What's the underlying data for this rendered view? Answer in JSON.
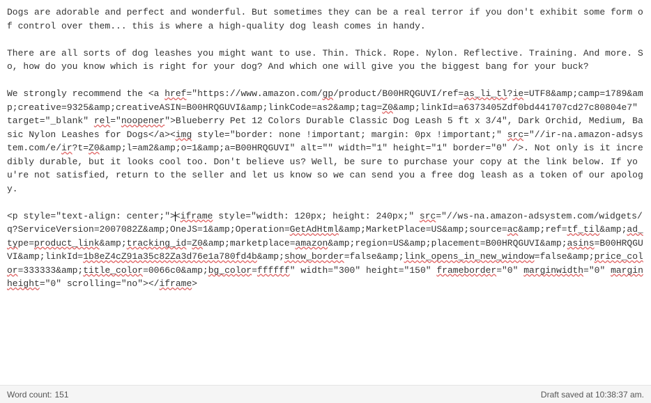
{
  "editor": {
    "para1": "Dogs are adorable and perfect and wonderful. But sometimes they can be a real terror if you don't exhibit some form of control over them... this is where a high-quality dog leash comes in handy.",
    "para2": "There are all sorts of dog leashes you might want to use. Thin. Thick. Rope. Nylon. Reflective. Training. And more. So, how do you know which is right for your dog? And which one will give you the biggest bang for your buck?",
    "p3_a": "We strongly recommend the <a ",
    "p3_href_attr": "href",
    "p3_b": "=\"https://www.amazon.com/",
    "p3_gp": "gp",
    "p3_c": "/product/B00HRQGUVI/ref=",
    "p3_asli": "as_li_tl",
    "p3_d": "?",
    "p3_ie": "ie",
    "p3_e": "=UTF8&amp;camp=1789&amp;creative=9325&amp;creativeASIN=B00HRQGUVI&amp;linkCode=as2&amp;tag=",
    "p3_z0a": "Z0",
    "p3_f": "&amp;linkId=a6373405Zdf0bd441707cd27c80804e7\" target=\"_blank\" ",
    "p3_rel": "rel",
    "p3_g": "=\"",
    "p3_noop": "noopener",
    "p3_h": "\">Blueberry Pet 12 Colors Durable Classic Dog Leash 5 ft x 3/4\", Dark Orchid, Medium, Basic Nylon Leashes for Dogs</a><",
    "p3_img": "img",
    "p3_i": " style=\"border: none !important; margin: 0px !important;\" ",
    "p3_src": "src",
    "p3_j": "=\"//ir-na.amazon-adsystem.com/e/",
    "p3_ir": "ir",
    "p3_k": "?t=",
    "p3_z0b": "Z0",
    "p3_l": "&amp;l=am2&amp;o=1&amp;a=B00HRQGUVI\" alt=\"\" width=\"1\" height=\"1\" border=\"0\" />. Not only is it incredibly durable, but it looks cool too. Don't believe us? Well, be sure to purchase your copy at the link below. If you're not satisfied, return to the seller and let us know so we can send you a free dog leash as a token of our apology.",
    "p4_a": "<p style=\"text-align: center;\">",
    "p4_b": "<",
    "p4_iframe": "iframe",
    "p4_c": " style=\"width: 120px; height: 240px;\" ",
    "p4_src": "src",
    "p4_d": "=\"//ws-na.amazon-adsystem.com/widgets/q?ServiceVersion=2007082Z&amp;OneJS=1&amp;Operation=",
    "p4_getad": "GetAdHtml",
    "p4_e": "&amp;MarketPlace=US&amp;source=",
    "p4_ac": "ac",
    "p4_f": "&amp;ref=",
    "p4_tf": "tf_til",
    "p4_g": "&amp;",
    "p4_adty": "ad_ty",
    "p4_h": "pe=",
    "p4_prodlink": "product_link",
    "p4_i": "&amp;",
    "p4_trk": "tracking_id",
    "p4_j": "=",
    "p4_z0c": "Z0",
    "p4_k": "&amp;marketplace=",
    "p4_amazon": "amazon",
    "p4_l": "&amp;region=US&amp;placement=B00HRQGUVI&amp;",
    "p4_asins": "asins",
    "p4_m": "=B00HRQGUVI&amp;linkId=",
    "p4_linkid": "1b8eZ4cZ91a35c82Za3d76e1a780fd4b",
    "p4_n": "&amp;",
    "p4_showb": "show_border",
    "p4_o": "=false&amp;",
    "p4_linkop": "link_opens_in_new_window",
    "p4_p": "=false&amp;",
    "p4_pcolor": "price_color",
    "p4_q": "=333333&amp;",
    "p4_tcolor": "title_color",
    "p4_r": "=0066c0&amp;",
    "p4_bgc": "bg_color",
    "p4_s": "=",
    "p4_fff": "ffffff",
    "p4_t": "\" width=\"300\" height=\"150\" ",
    "p4_fb": "frameborder",
    "p4_u": "=\"0\" ",
    "p4_mw": "marginwidth",
    "p4_v": "=\"0\" ",
    "p4_mh": "marginheight",
    "p4_w": "=\"0\" scrolling=\"no\"></",
    "p4_iframe2": "iframe",
    "p4_x": ">"
  },
  "status": {
    "word_count_label": "Word count:",
    "word_count_value": "151",
    "draft_saved": "Draft saved at 10:38:37 am."
  }
}
